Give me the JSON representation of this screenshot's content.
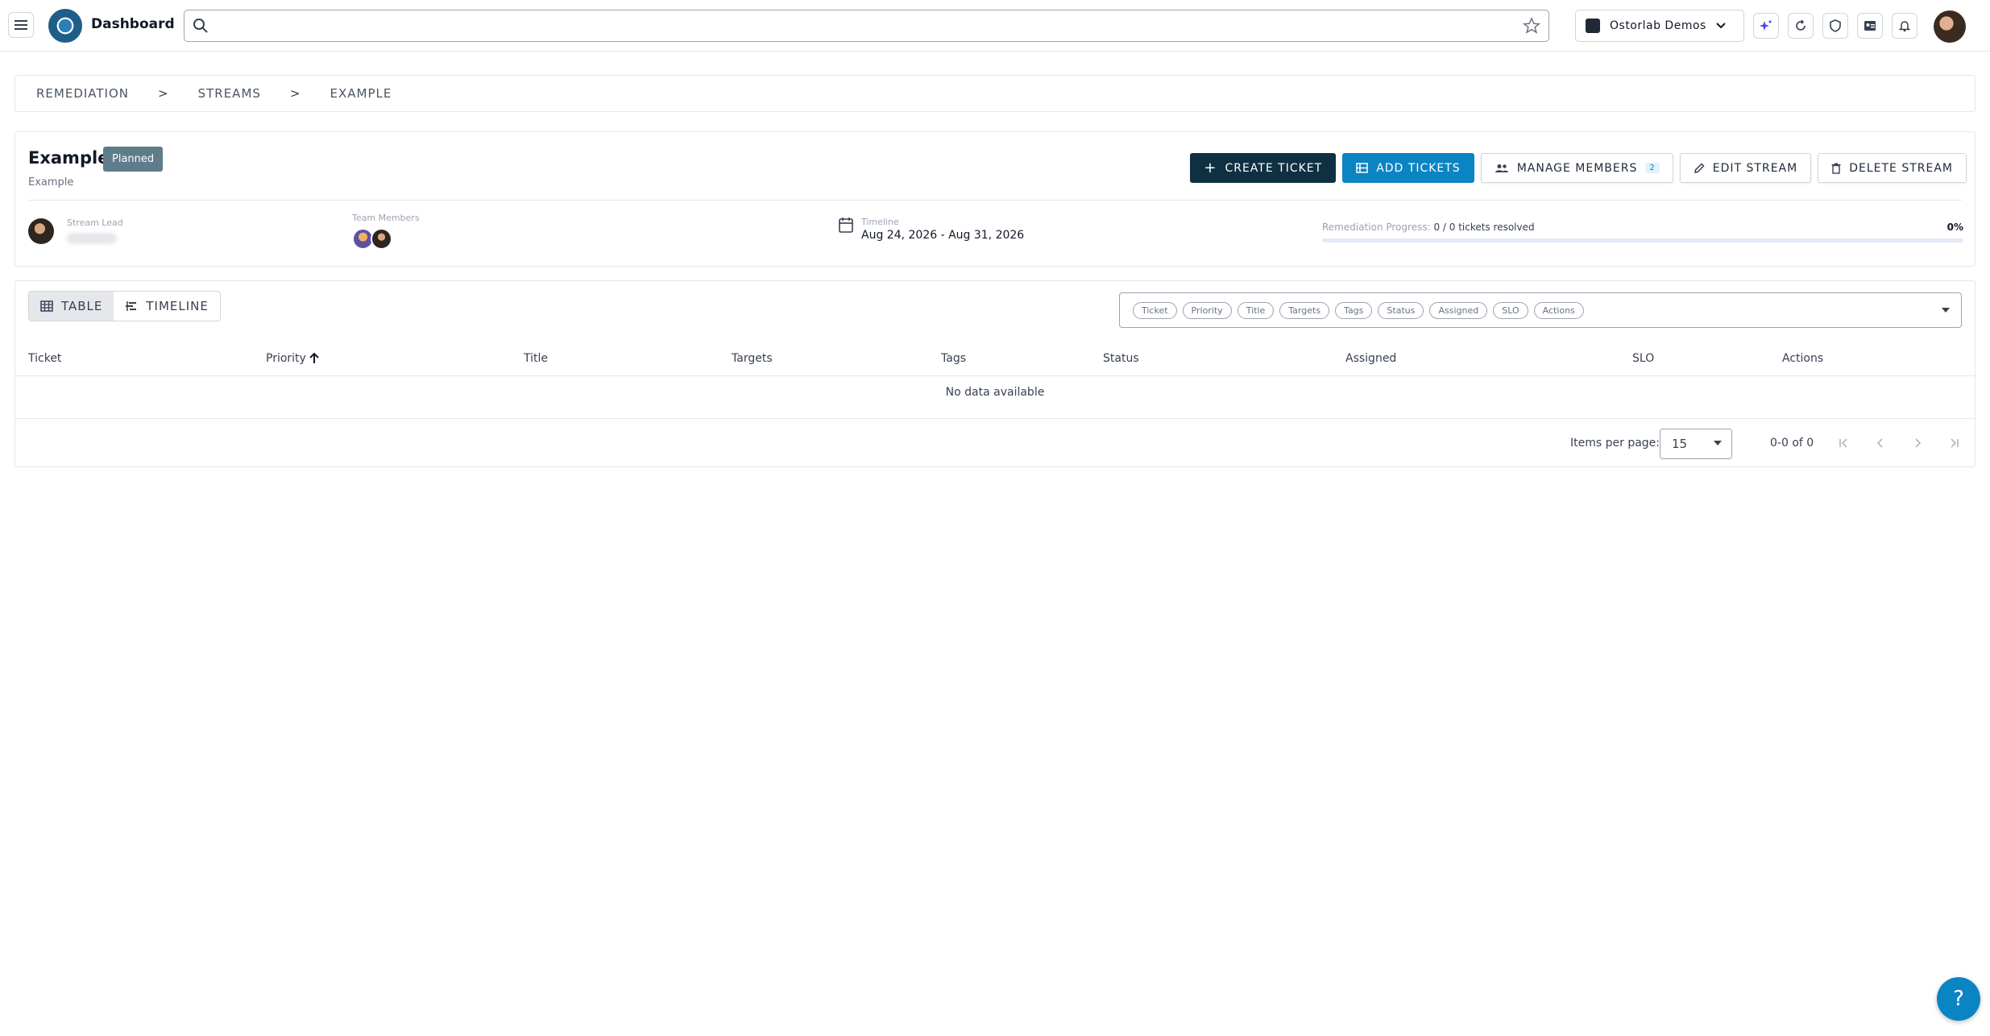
{
  "header": {
    "brand": "Dashboard",
    "search_value": "",
    "org_name": "Ostorlab Demos"
  },
  "breadcrumb": {
    "items": [
      "REMEDIATION",
      "STREAMS",
      "EXAMPLE"
    ],
    "separator": ">"
  },
  "stream": {
    "title": "Example",
    "status_badge": "Planned",
    "description": "Example",
    "actions": {
      "create_ticket": "CREATE TICKET",
      "add_tickets": "ADD TICKETS",
      "manage_members": "MANAGE MEMBERS",
      "members_count": "2",
      "edit_stream": "EDIT STREAM",
      "delete_stream": "DELETE STREAM"
    },
    "lead_label": "Stream Lead",
    "members_label": "Team Members",
    "timeline_label": "Timeline",
    "timeline_value": "Aug 24, 2026 - Aug 31, 2026",
    "progress_label": "Remediation Progress:",
    "progress_text": "0 / 0 tickets resolved",
    "progress_percent": "0%",
    "progress_fraction": 0
  },
  "table": {
    "view_toggle": {
      "table": "TABLE",
      "timeline": "TIMELINE"
    },
    "column_chips": [
      "Ticket",
      "Priority",
      "Title",
      "Targets",
      "Tags",
      "Status",
      "Assigned",
      "SLO",
      "Actions"
    ],
    "columns": [
      "Ticket",
      "Priority",
      "Title",
      "Targets",
      "Tags",
      "Status",
      "Assigned",
      "SLO",
      "Actions"
    ],
    "empty_text": "No data available",
    "items_per_page_label": "Items per page:",
    "items_per_page": "15",
    "range_text": "0-0 of 0"
  },
  "help": {
    "label": "?"
  },
  "colors": {
    "primary_dark": "#0f3042",
    "accent_blue": "#0b84c4",
    "badge_grey": "#5f7c8a"
  }
}
